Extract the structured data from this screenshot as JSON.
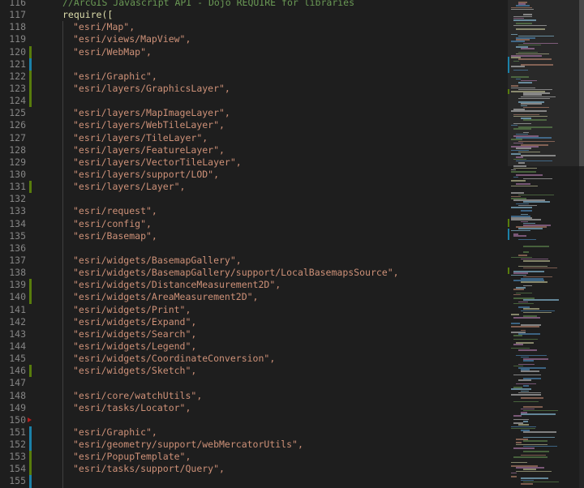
{
  "editor": {
    "lines": [
      {
        "num": "116",
        "kind": "comment",
        "text": "//ArcGIS Javascript API - Dojo REQUIRE for libraries",
        "mark": ""
      },
      {
        "num": "117",
        "kind": "call",
        "text": "require([",
        "mark": ""
      },
      {
        "num": "118",
        "kind": "string",
        "text": "\"esri/Map\",",
        "mark": ""
      },
      {
        "num": "119",
        "kind": "string",
        "text": "\"esri/views/MapView\",",
        "mark": ""
      },
      {
        "num": "120",
        "kind": "string",
        "text": "\"esri/WebMap\",",
        "mark": "green"
      },
      {
        "num": "121",
        "kind": "blank",
        "text": "",
        "mark": "blue"
      },
      {
        "num": "122",
        "kind": "string",
        "text": "\"esri/Graphic\",",
        "mark": "green"
      },
      {
        "num": "123",
        "kind": "string",
        "text": "\"esri/layers/GraphicsLayer\",",
        "mark": "green"
      },
      {
        "num": "124",
        "kind": "blank",
        "text": "",
        "mark": "green"
      },
      {
        "num": "125",
        "kind": "string",
        "text": "\"esri/layers/MapImageLayer\",",
        "mark": ""
      },
      {
        "num": "126",
        "kind": "string",
        "text": "\"esri/layers/WebTileLayer\",",
        "mark": ""
      },
      {
        "num": "127",
        "kind": "string",
        "text": "\"esri/layers/TileLayer\",",
        "mark": ""
      },
      {
        "num": "128",
        "kind": "string",
        "text": "\"esri/layers/FeatureLayer\",",
        "mark": ""
      },
      {
        "num": "129",
        "kind": "string",
        "text": "\"esri/layers/VectorTileLayer\",",
        "mark": ""
      },
      {
        "num": "130",
        "kind": "string",
        "text": "\"esri/layers/support/LOD\",",
        "mark": ""
      },
      {
        "num": "131",
        "kind": "string",
        "text": "\"esri/layers/Layer\",",
        "mark": "green"
      },
      {
        "num": "132",
        "kind": "blank",
        "text": "",
        "mark": ""
      },
      {
        "num": "133",
        "kind": "string",
        "text": "\"esri/request\",",
        "mark": ""
      },
      {
        "num": "134",
        "kind": "string",
        "text": "\"esri/config\",",
        "mark": ""
      },
      {
        "num": "135",
        "kind": "string",
        "text": "\"esri/Basemap\",",
        "mark": ""
      },
      {
        "num": "136",
        "kind": "blank",
        "text": "",
        "mark": ""
      },
      {
        "num": "137",
        "kind": "string",
        "text": "\"esri/widgets/BasemapGallery\",",
        "mark": ""
      },
      {
        "num": "138",
        "kind": "string",
        "text": "\"esri/widgets/BasemapGallery/support/LocalBasemapsSource\",",
        "mark": ""
      },
      {
        "num": "139",
        "kind": "string",
        "text": "\"esri/widgets/DistanceMeasurement2D\",",
        "mark": "green"
      },
      {
        "num": "140",
        "kind": "string",
        "text": "\"esri/widgets/AreaMeasurement2D\",",
        "mark": "green"
      },
      {
        "num": "141",
        "kind": "string",
        "text": "\"esri/widgets/Print\",",
        "mark": ""
      },
      {
        "num": "142",
        "kind": "string",
        "text": "\"esri/widgets/Expand\",",
        "mark": ""
      },
      {
        "num": "143",
        "kind": "string",
        "text": "\"esri/widgets/Search\",",
        "mark": ""
      },
      {
        "num": "144",
        "kind": "string",
        "text": "\"esri/widgets/Legend\",",
        "mark": ""
      },
      {
        "num": "145",
        "kind": "string",
        "text": "\"esri/widgets/CoordinateConversion\",",
        "mark": ""
      },
      {
        "num": "146",
        "kind": "string",
        "text": "\"esri/widgets/Sketch\",",
        "mark": "green"
      },
      {
        "num": "147",
        "kind": "blank",
        "text": "",
        "mark": ""
      },
      {
        "num": "148",
        "kind": "string",
        "text": "\"esri/core/watchUtils\",",
        "mark": ""
      },
      {
        "num": "149",
        "kind": "string",
        "text": "\"esri/tasks/Locator\",",
        "mark": ""
      },
      {
        "num": "150",
        "kind": "blank",
        "text": "",
        "mark": "red"
      },
      {
        "num": "151",
        "kind": "string",
        "text": "\"esri/Graphic\",",
        "mark": "blue"
      },
      {
        "num": "152",
        "kind": "string",
        "text": "\"esri/geometry/support/webMercatorUtils\",",
        "mark": "blue"
      },
      {
        "num": "153",
        "kind": "string",
        "text": "\"esri/PopupTemplate\",",
        "mark": "green"
      },
      {
        "num": "154",
        "kind": "string",
        "text": "\"esri/tasks/support/Query\",",
        "mark": "green"
      },
      {
        "num": "155",
        "kind": "blank",
        "text": "",
        "mark": "blue"
      }
    ]
  },
  "colors": {
    "background": "#1e1e1e",
    "line_number": "#858585",
    "comment": "#6a9955",
    "string": "#ce9178",
    "function": "#dcdcaa",
    "gutter_added": "#587c0c",
    "gutter_modified": "#1b81a8",
    "gutter_deleted": "#b21d1d"
  }
}
